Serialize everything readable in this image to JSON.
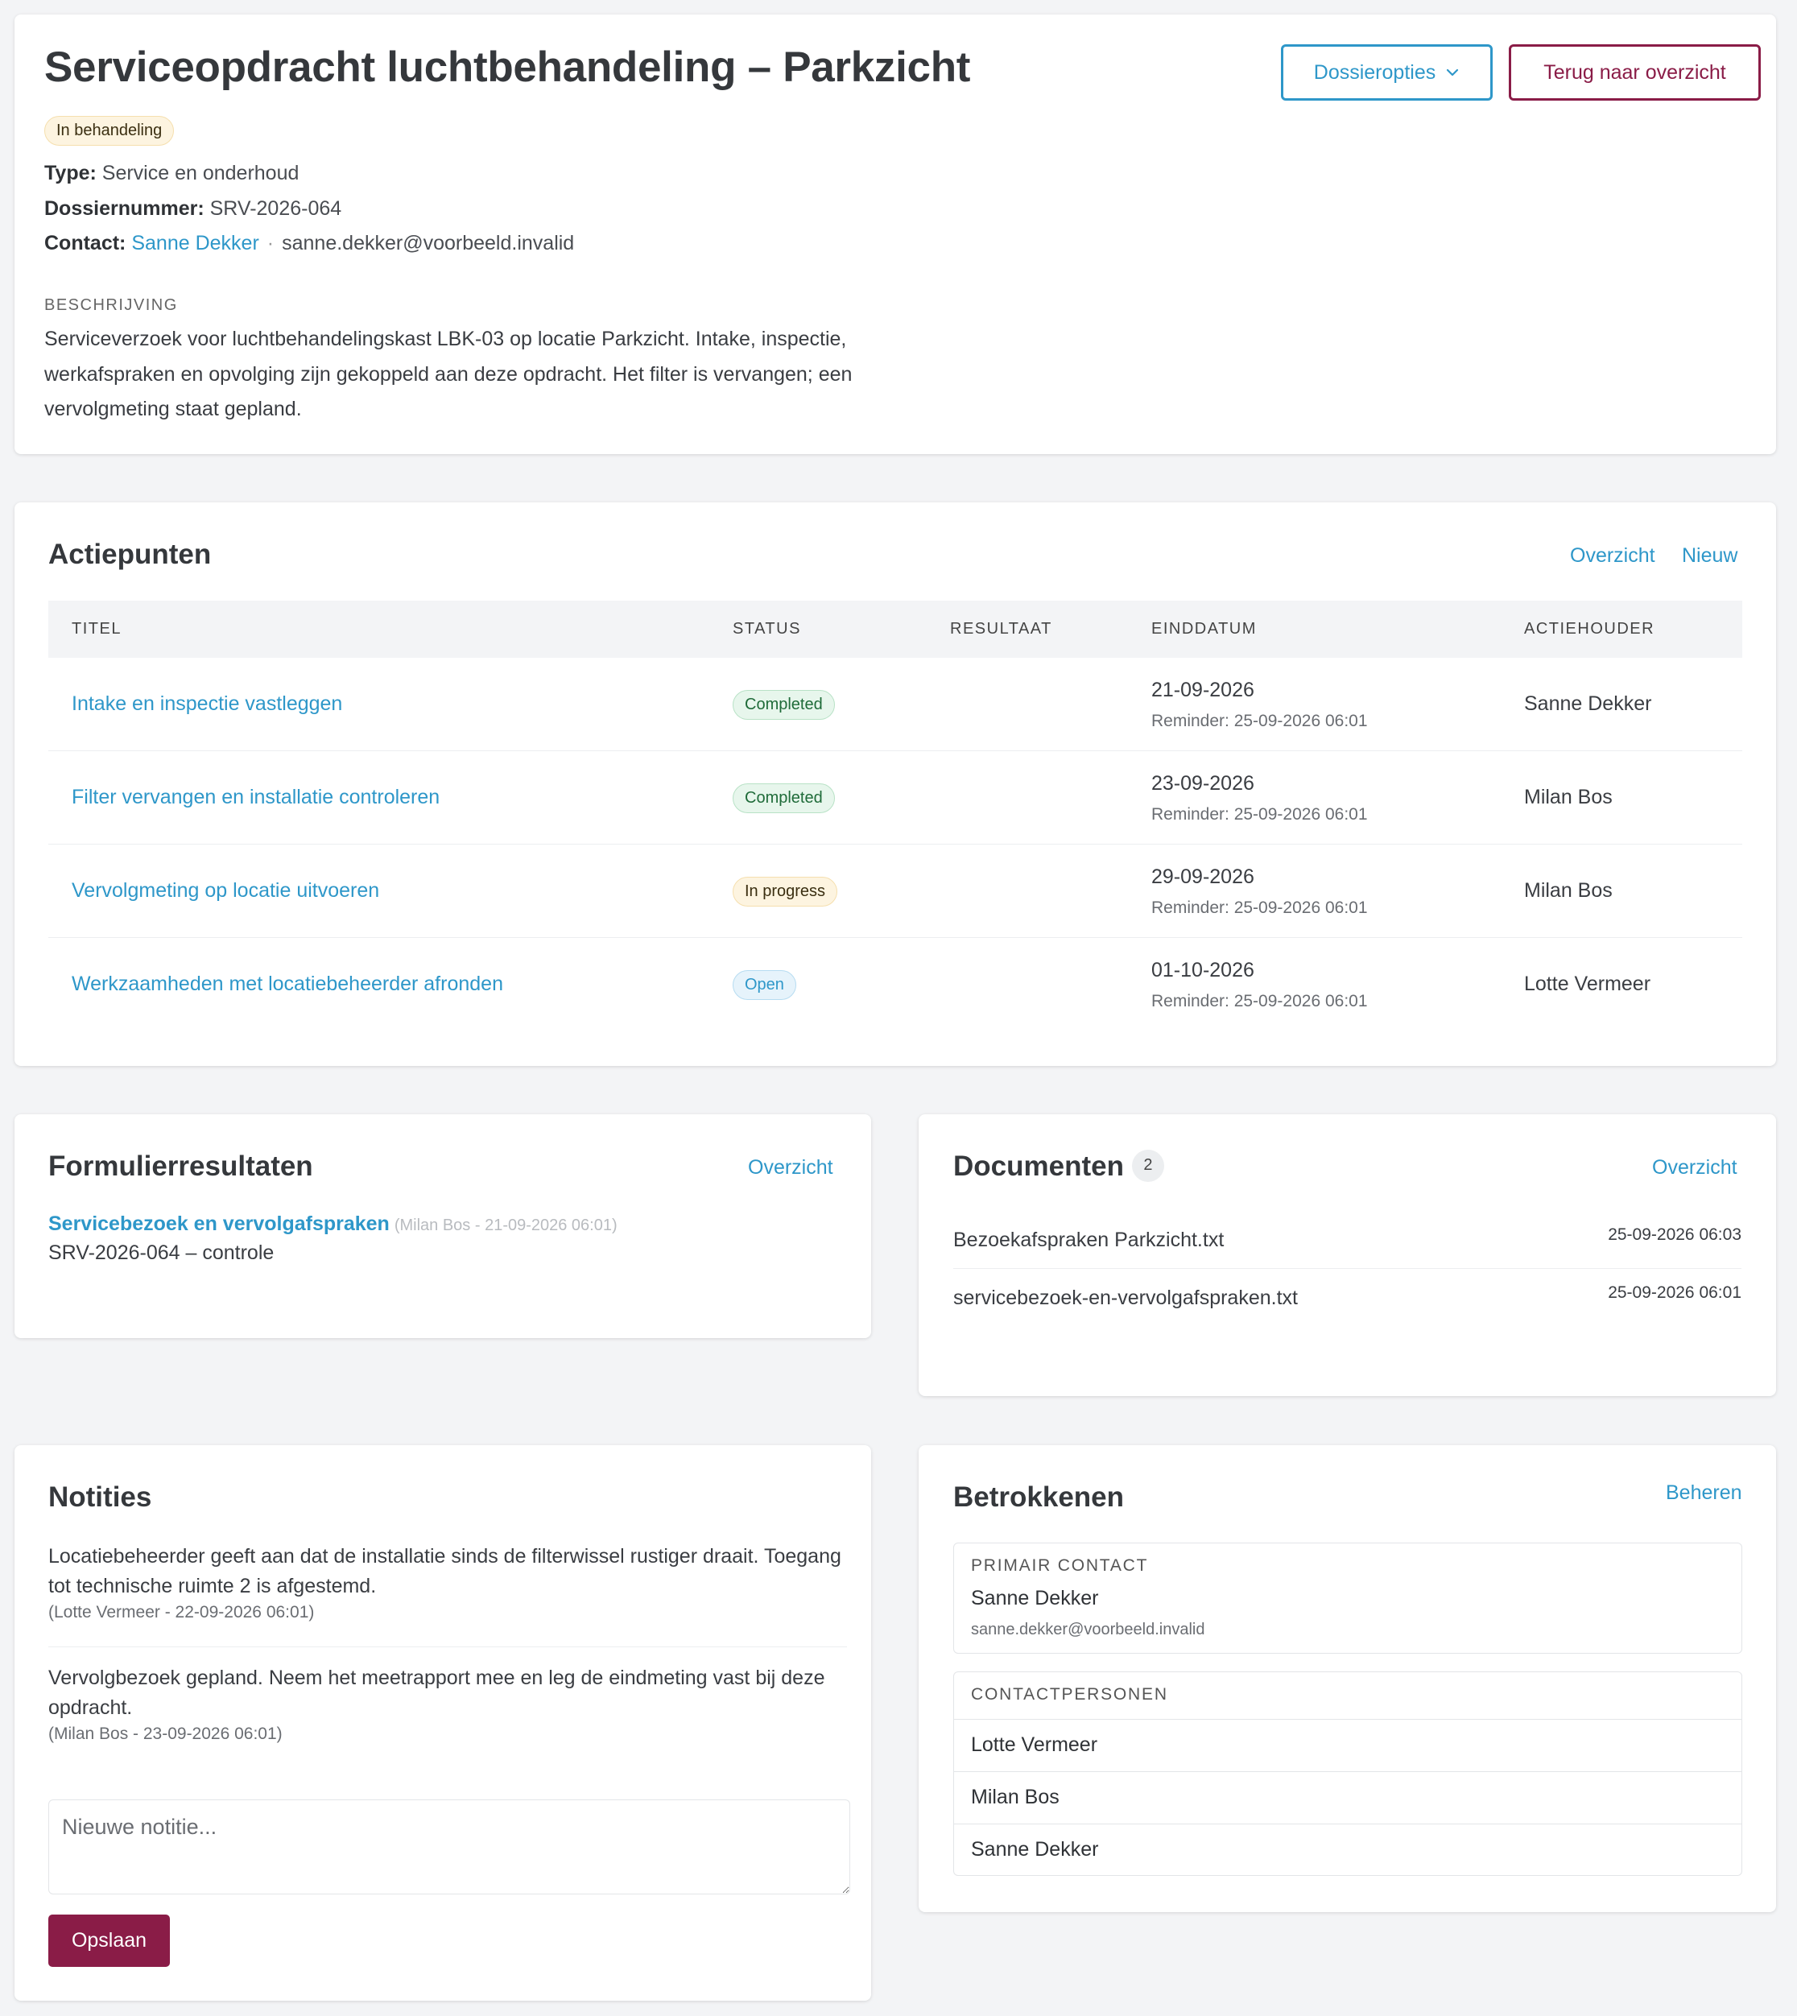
{
  "header": {
    "title": "Serviceopdracht luchtbehandeling – Parkzicht",
    "status_badge": "In behandeling",
    "dossier_options_label": "Dossieropties",
    "back_label": "Terug naar overzicht",
    "type_label": "Type:",
    "type_value": "Service en onderhoud",
    "dossier_label": "Dossiernummer:",
    "dossier_value": "SRV-2026-064",
    "contact_label": "Contact:",
    "contact_name": "Sanne Dekker",
    "contact_separator": "·",
    "contact_email": "sanne.dekker@voorbeeld.invalid",
    "description_caption": "BESCHRIJVING",
    "description": "Serviceverzoek voor luchtbehandelingskast LBK-03 op locatie Parkzicht. Intake, inspectie, werkafspraken en opvolging zijn gekoppeld aan deze opdracht. Het filter is vervangen; een vervolgmeting staat gepland."
  },
  "actions": {
    "title": "Actiepunten",
    "overview_label": "Overzicht",
    "new_label": "Nieuw",
    "columns": [
      "TITEL",
      "STATUS",
      "RESULTAAT",
      "EINDDATUM",
      "ACTIEHOUDER"
    ],
    "rows": [
      {
        "title": "Intake en inspectie vastleggen",
        "status": "Completed",
        "status_kind": "green",
        "result": "",
        "date": "21-09-2026",
        "reminder": "Reminder: 25-09-2026 06:01",
        "owner": "Sanne Dekker"
      },
      {
        "title": "Filter vervangen en installatie controleren",
        "status": "Completed",
        "status_kind": "green",
        "result": "",
        "date": "23-09-2026",
        "reminder": "Reminder: 25-09-2026 06:01",
        "owner": "Milan Bos"
      },
      {
        "title": "Vervolgmeting op locatie uitvoeren",
        "status": "In progress",
        "status_kind": "yellow",
        "result": "",
        "date": "29-09-2026",
        "reminder": "Reminder: 25-09-2026 06:01",
        "owner": "Milan Bos"
      },
      {
        "title": "Werkzaamheden met locatiebeheerder afronden",
        "status": "Open",
        "status_kind": "blue",
        "result": "",
        "date": "01-10-2026",
        "reminder": "Reminder: 25-09-2026 06:01",
        "owner": "Lotte Vermeer"
      }
    ]
  },
  "forms": {
    "title": "Formulierresultaten",
    "overview_label": "Overzicht",
    "item_title": "Servicebezoek en vervolgafspraken",
    "item_meta": "(Milan Bos - 21-09-2026 06:01)",
    "item_sub": "SRV-2026-064 – controle"
  },
  "documents": {
    "title": "Documenten",
    "count": "2",
    "overview_label": "Overzicht",
    "items": [
      {
        "name": "Bezoekafspraken Parkzicht.txt",
        "date": "25-09-2026 06:03"
      },
      {
        "name": "servicebezoek-en-vervolgafspraken.txt",
        "date": "25-09-2026 06:01"
      }
    ]
  },
  "notes": {
    "title": "Notities",
    "items": [
      {
        "text": "Locatiebeheerder geeft aan dat de installatie sinds de filterwissel rustiger draait. Toegang tot technische ruimte 2 is afgestemd.",
        "meta": "(Lotte Vermeer - 22-09-2026 06:01)"
      },
      {
        "text": "Vervolgbezoek gepland. Neem het meetrapport mee en leg de eindmeting vast bij deze opdracht.",
        "meta": "(Milan Bos - 23-09-2026 06:01)"
      }
    ],
    "placeholder": "Nieuwe notitie...",
    "save_label": "Opslaan"
  },
  "people": {
    "title": "Betrokkenen",
    "manage_label": "Beheren",
    "primary_caption": "PRIMAIR CONTACT",
    "primary_name": "Sanne Dekker",
    "primary_email": "sanne.dekker@voorbeeld.invalid",
    "contacts_caption": "CONTACTPERSONEN",
    "contacts": [
      "Lotte Vermeer",
      "Milan Bos",
      "Sanne Dekker"
    ]
  },
  "colors": {
    "brand_accent": "#8a1c47",
    "link_blue": "#2e97c9",
    "background": "#f3f4f6"
  },
  "icons": {
    "dossier_dropdown": "chevron-down-icon",
    "textarea_resize": "resize-handle-icon"
  }
}
